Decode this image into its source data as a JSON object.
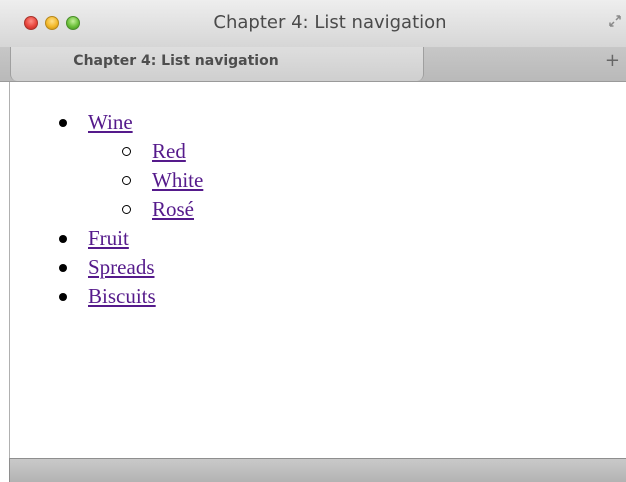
{
  "window": {
    "title": "Chapter 4: List navigation"
  },
  "tabs": [
    {
      "label": "Chapter 4: List navigation",
      "active": true
    }
  ],
  "new_tab_symbol": "+",
  "nav": {
    "items": [
      {
        "label": "Wine",
        "children": [
          {
            "label": "Red"
          },
          {
            "label": "White"
          },
          {
            "label": "Rosé"
          }
        ]
      },
      {
        "label": "Fruit"
      },
      {
        "label": "Spreads"
      },
      {
        "label": "Biscuits"
      }
    ]
  },
  "colors": {
    "link_visited": "#551a8b",
    "close": "#e8463d",
    "minimize": "#f3b92a",
    "zoom": "#6cc13a"
  }
}
